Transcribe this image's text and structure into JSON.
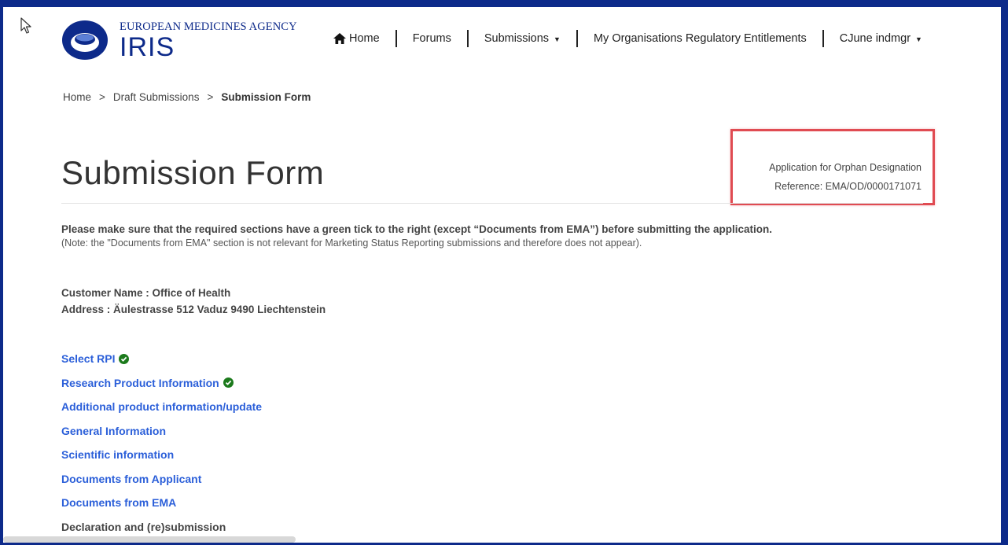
{
  "header": {
    "agency": "EUROPEAN MEDICINES AGENCY",
    "product": "IRIS"
  },
  "nav": {
    "home": "Home",
    "forums": "Forums",
    "submissions": "Submissions",
    "entitlements": "My Organisations Regulatory Entitlements",
    "user": "CJune indmgr"
  },
  "breadcrumb": {
    "home": "Home",
    "draft": "Draft Submissions",
    "current": "Submission Form",
    "separator": ">"
  },
  "page": {
    "title": "Submission Form",
    "application_type": "Application for Orphan Designation",
    "reference": "Reference: EMA/OD/0000171071"
  },
  "notice": {
    "main": "Please make sure that the required sections have a green tick to the right (except “Documents from EMA”) before submitting the application.",
    "note": "(Note: the \"Documents from EMA\" section is not relevant for Marketing Status Reporting submissions and therefore does not appear)."
  },
  "customer": {
    "name": "Customer Name : Office of Health",
    "address": "Address : Äulestrasse 512 Vaduz 9490 Liechtenstein"
  },
  "sections": {
    "select_rpi": "Select RPI",
    "research_product": "Research Product Information",
    "additional_product": "Additional product information/update",
    "general_info": "General Information",
    "scientific_info": "Scientific information",
    "docs_applicant": "Documents from Applicant",
    "docs_ema": "Documents from EMA",
    "declaration": "Declaration and (re)submission"
  },
  "icons": {
    "home": "home-icon",
    "caret": "caret-down-icon",
    "complete": "check-circle-icon"
  },
  "colors": {
    "brand": "#0d2a8a",
    "link": "#2b5fd9",
    "tick": "#1c7a1c",
    "highlight": "#e04b52"
  }
}
